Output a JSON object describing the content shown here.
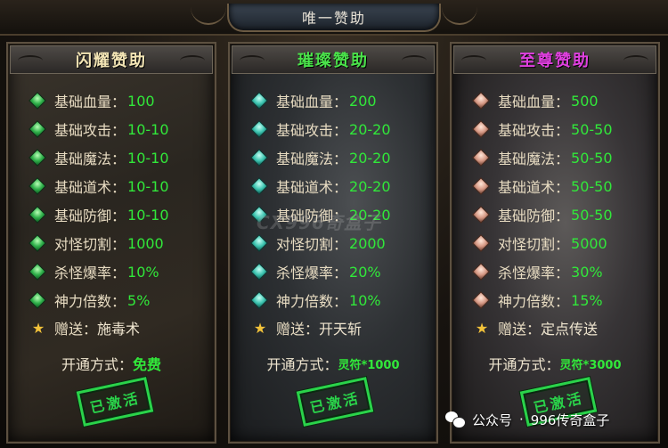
{
  "header": {
    "title": "唯一赞助"
  },
  "panels": [
    {
      "title": "闪耀赞助",
      "title_color": "#f2e4b4",
      "gem": "green",
      "stats": [
        {
          "label": "基础血量：",
          "value": "100"
        },
        {
          "label": "基础攻击：",
          "value": "10-10"
        },
        {
          "label": "基础魔法：",
          "value": "10-10"
        },
        {
          "label": "基础道术：",
          "value": "10-10"
        },
        {
          "label": "基础防御：",
          "value": "10-10"
        },
        {
          "label": "对怪切割：",
          "value": "1000"
        },
        {
          "label": "杀怪爆率：",
          "value": "10%"
        },
        {
          "label": "神力倍数：",
          "value": "5%"
        }
      ],
      "gift": {
        "label": "赠送：",
        "value": "施毒术"
      },
      "open": {
        "label": "开通方式：",
        "value": "免费"
      },
      "stamp": "已激活"
    },
    {
      "title": "璀璨赞助",
      "title_color": "#4ae24a",
      "gem": "teal",
      "stats": [
        {
          "label": "基础血量：",
          "value": "200"
        },
        {
          "label": "基础攻击：",
          "value": "20-20"
        },
        {
          "label": "基础魔法：",
          "value": "20-20"
        },
        {
          "label": "基础道术：",
          "value": "20-20"
        },
        {
          "label": "基础防御：",
          "value": "20-20"
        },
        {
          "label": "对怪切割：",
          "value": "2000"
        },
        {
          "label": "杀怪爆率：",
          "value": "20%"
        },
        {
          "label": "神力倍数：",
          "value": "10%"
        }
      ],
      "gift": {
        "label": "赠送：",
        "value": "开天斩"
      },
      "open": {
        "label": "开通方式：",
        "value": "灵符*1000"
      },
      "stamp": "已激活"
    },
    {
      "title": "至尊赞助",
      "title_color": "#e040e0",
      "gem": "pink",
      "stats": [
        {
          "label": "基础血量：",
          "value": "500"
        },
        {
          "label": "基础攻击：",
          "value": "50-50"
        },
        {
          "label": "基础魔法：",
          "value": "50-50"
        },
        {
          "label": "基础道术：",
          "value": "50-50"
        },
        {
          "label": "基础防御：",
          "value": "50-50"
        },
        {
          "label": "对怪切割：",
          "value": "5000"
        },
        {
          "label": "杀怪爆率：",
          "value": "30%"
        },
        {
          "label": "神力倍数：",
          "value": "15%"
        }
      ],
      "gift": {
        "label": "赠送：",
        "value": "定点传送"
      },
      "open": {
        "label": "开通方式：",
        "value": "灵符*3000"
      },
      "stamp": "已激活"
    }
  ],
  "watermark": {
    "account_type": "公众号",
    "separator": "·",
    "account_name": "996传奇盒子"
  },
  "faint_watermark": "CX996奇盒子"
}
